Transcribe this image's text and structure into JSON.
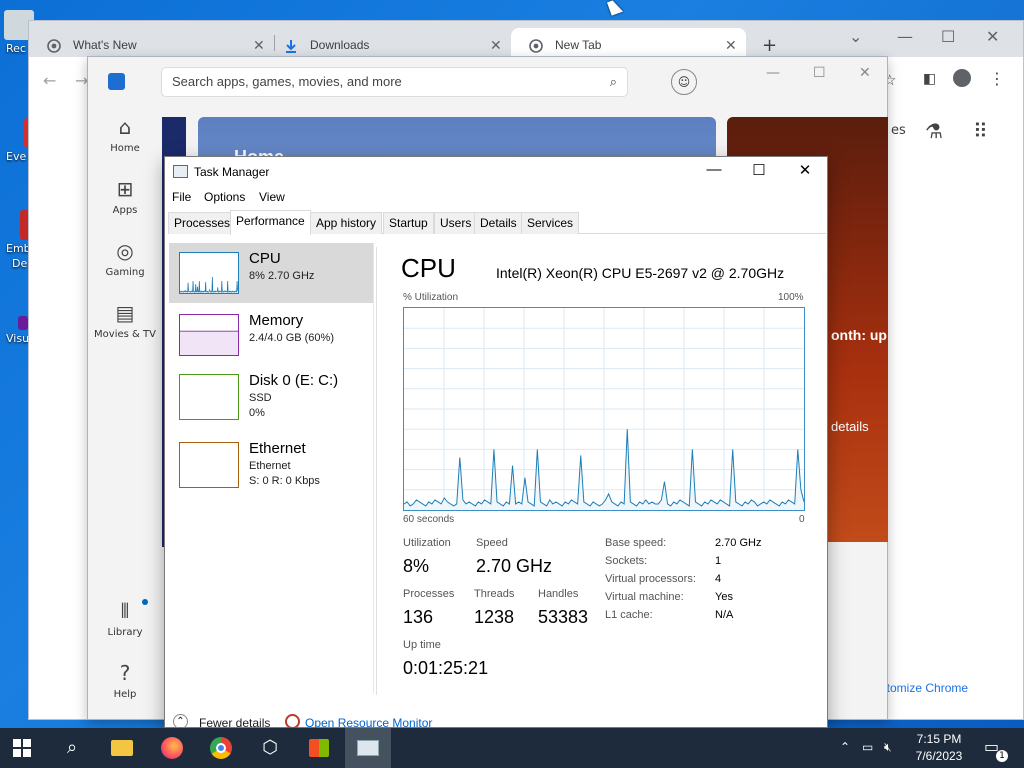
{
  "desktop": {
    "icons": [
      {
        "label": "Rec",
        "color": "#cfd8dc"
      },
      {
        "label": "Eve",
        "color": "#d32f2f"
      },
      {
        "label": "Emb",
        "color": "#c62828"
      },
      {
        "label": "De",
        "color": "#c62828"
      },
      {
        "label": "Visu",
        "color": "#6a1b9a"
      }
    ]
  },
  "chrome": {
    "tabs": [
      {
        "title": "What's New",
        "icon": "chrome-icon"
      },
      {
        "title": "Downloads",
        "icon": "download-icon"
      },
      {
        "title": "New Tab",
        "icon": "chrome-icon"
      }
    ],
    "new_tab": "+",
    "customize": "ustomize Chrome",
    "page_fragments": {
      "top_right": "es"
    }
  },
  "store": {
    "search_placeholder": "Search apps, games, movies, and more",
    "nav": [
      {
        "label": "Home",
        "icon": "home-icon"
      },
      {
        "label": "Apps",
        "icon": "apps-icon"
      },
      {
        "label": "Gaming",
        "icon": "gaming-icon"
      },
      {
        "label": "Movies & TV",
        "icon": "movies-icon"
      },
      {
        "label": "Library",
        "icon": "library-icon"
      },
      {
        "label": "Help",
        "icon": "help-icon"
      }
    ],
    "banner_texts": {
      "home": "Home",
      "month": "onth: up",
      "details": "details"
    }
  },
  "taskmanager": {
    "title": "Task Manager",
    "menu": [
      "File",
      "Options",
      "View"
    ],
    "tabs": [
      "Processes",
      "Performance",
      "App history",
      "Startup",
      "Users",
      "Details",
      "Services"
    ],
    "active_tab": "Performance",
    "resources": [
      {
        "name": "CPU",
        "sub1": "8% 2.70 GHz",
        "sub2": "",
        "color": "#1d7fb8"
      },
      {
        "name": "Memory",
        "sub1": "2.4/4.0 GB (60%)",
        "sub2": "",
        "color": "#8b2aa8"
      },
      {
        "name": "Disk 0 (E: C:)",
        "sub1": "SSD",
        "sub2": "0%",
        "color": "#4d9a1a"
      },
      {
        "name": "Ethernet",
        "sub1": "Ethernet",
        "sub2": "S: 0 R: 0 Kbps",
        "color": "#a65f0c"
      }
    ],
    "detail": {
      "heading": "CPU",
      "model": "Intel(R) Xeon(R) CPU E5-2697 v2 @ 2.70GHz",
      "y_axis_label": "% Utilization",
      "y_axis_max": "100%",
      "x_axis_left": "60 seconds",
      "x_axis_right": "0",
      "stats": {
        "utilization_label": "Utilization",
        "utilization": "8%",
        "speed_label": "Speed",
        "speed": "2.70 GHz",
        "processes_label": "Processes",
        "processes": "136",
        "threads_label": "Threads",
        "threads": "1238",
        "handles_label": "Handles",
        "handles": "53383",
        "uptime_label": "Up time",
        "uptime": "0:01:25:21"
      },
      "specs": [
        {
          "label": "Base speed:",
          "value": "2.70 GHz"
        },
        {
          "label": "Sockets:",
          "value": "1"
        },
        {
          "label": "Virtual processors:",
          "value": "4"
        },
        {
          "label": "Virtual machine:",
          "value": "Yes"
        },
        {
          "label": "L1 cache:",
          "value": "N/A"
        }
      ]
    },
    "footer": {
      "fewer": "Fewer details",
      "monitor": "Open Resource Monitor"
    },
    "graph_color": "#1d7fb8",
    "cpu_series": [
      3,
      4,
      2,
      3,
      5,
      4,
      3,
      2,
      4,
      3,
      5,
      4,
      3,
      6,
      4,
      3,
      2,
      3,
      26,
      5,
      3,
      4,
      3,
      2,
      4,
      3,
      5,
      4,
      3,
      30,
      4,
      3,
      2,
      4,
      3,
      22,
      3,
      4,
      3,
      16,
      4,
      3,
      2,
      30,
      4,
      3,
      2,
      5,
      3,
      4,
      3,
      2,
      4,
      3,
      5,
      4,
      3,
      27,
      4,
      3,
      2,
      4,
      3,
      2,
      3,
      5,
      8,
      4,
      3,
      2,
      4,
      3,
      40,
      4,
      3,
      2,
      4,
      3,
      5,
      3,
      4,
      3,
      3,
      5,
      14,
      3,
      2,
      4,
      3,
      5,
      4,
      3,
      2,
      30,
      4,
      3,
      2,
      4,
      3,
      5,
      4,
      3,
      5,
      4,
      3,
      2,
      30,
      4,
      3,
      2,
      4,
      3,
      5,
      4,
      2,
      3,
      4,
      3,
      5,
      4,
      3,
      2,
      4,
      3,
      5,
      4,
      3,
      30,
      10,
      4
    ]
  },
  "taskbar": {
    "time": "7:15 PM",
    "date": "7/6/2023",
    "notification_count": "1"
  }
}
